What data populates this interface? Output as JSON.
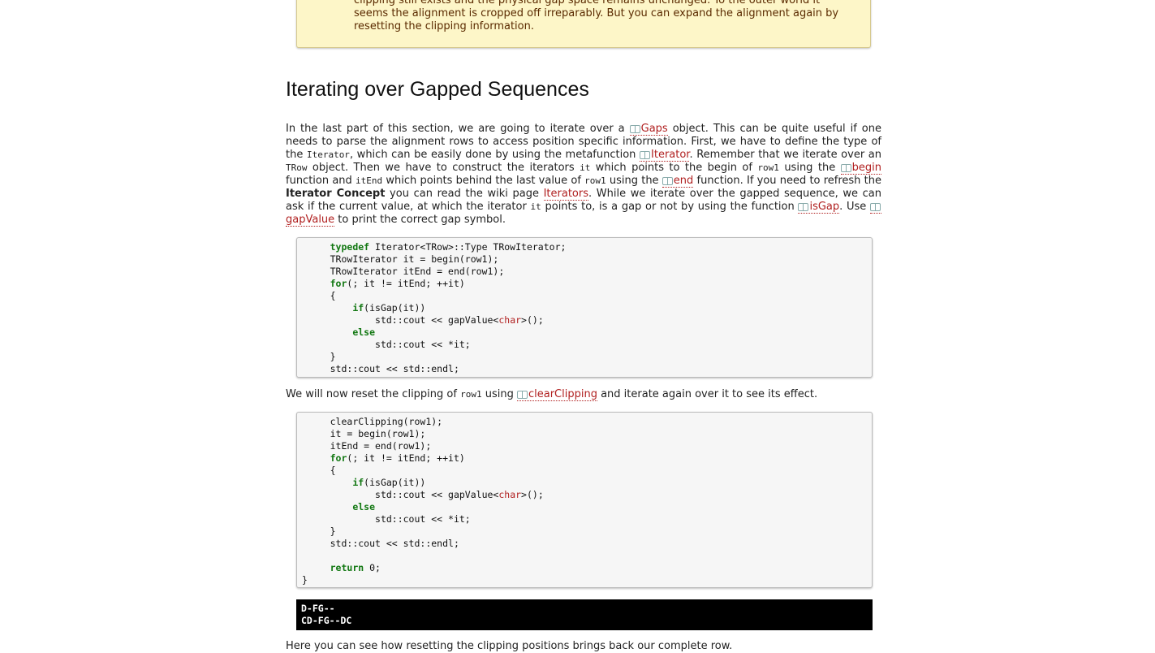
{
  "note": {
    "line1": "clipping still exists and the physical gap space remains unchanged. To the outer world it",
    "line2": "seems the alignment is cropped off irreparably. But you can expand the alignment again by",
    "line3": "resetting the clipping information."
  },
  "section_title": "Iterating over Gapped Sequences",
  "para1": {
    "s1": "In the last part of this section, we are going to iterate over a ",
    "ref_gaps": "Gaps",
    "s2": " object. This can be quite useful if one needs to parse the alignment rows to access position specific information. First, we have to define the type of the ",
    "c_iterator": "Iterator",
    "s3": ", which can be easily done by using the metafunction ",
    "ref_iterator": "Iterator",
    "s4": ". Remember that we iterate over an ",
    "c_trow": "TRow",
    "s5": " object. Then we have to construct the iterators ",
    "c_it": "it",
    "s6": " which points to the begin of ",
    "c_row1a": "row1",
    "s7": " using the ",
    "ref_begin": "begin",
    "s8": " function and ",
    "c_itend": "itEnd",
    "s9": " which points behind the last value of ",
    "c_row1b": "row1",
    "s10": " using the ",
    "ref_end": "end",
    "s11": " function. If you need to refresh the ",
    "bold": "Iterator Concept",
    "s12": " you can read the wiki page ",
    "wiki": "Iterators",
    "s13": ". While we iterate over the gapped sequence, we can ask if the current value, at which the iterator ",
    "c_it2": "it",
    "s14": " points to, is a gap or not by using the function ",
    "ref_isgap": "isGap",
    "s15": ". Use ",
    "ref_gapvalue": "gapValue",
    "s16": " to print the correct gap symbol."
  },
  "code1": {
    "l1_kw": "typedef",
    "l1_rest": " Iterator<TRow>::Type TRowIterator;",
    "l2": "TRowIterator it = begin(row1);",
    "l3": "TRowIterator itEnd = end(row1);",
    "l4_kw": "for",
    "l4_rest": "(; it != itEnd; ++it)",
    "l5": "{",
    "l6_kw": "if",
    "l6_rest": "(isGap(it))",
    "l7_a": "std::cout << gapValue<",
    "l7_ty": "char",
    "l7_b": ">();",
    "l8_kw": "else",
    "l9": "std::cout << *it;",
    "l10": "}",
    "l11": "std::cout << std::endl;"
  },
  "para2": {
    "s1": "We will now reset the clipping of ",
    "c_row1": "row1",
    "s2": " using ",
    "ref": "clearClipping",
    "s3": " and iterate again over it to see its effect."
  },
  "code2": {
    "l1": "clearClipping(row1);",
    "l2": "it = begin(row1);",
    "l3": "itEnd = end(row1);",
    "l4_kw": "for",
    "l4_rest": "(; it != itEnd; ++it)",
    "l5": "{",
    "l6_kw": "if",
    "l6_rest": "(isGap(it))",
    "l7_a": "std::cout << gapValue<",
    "l7_ty": "char",
    "l7_b": ">();",
    "l8_kw": "else",
    "l9": "std::cout << *it;",
    "l10": "}",
    "l11": "std::cout << std::endl;",
    "l13_kw": "return",
    "l13_rest": " 0;",
    "l14": "}"
  },
  "output": {
    "l1": "D-FG--",
    "l2": "CD-FG--DC"
  },
  "para3": "Here you can see how resetting the clipping positions brings back our complete row."
}
